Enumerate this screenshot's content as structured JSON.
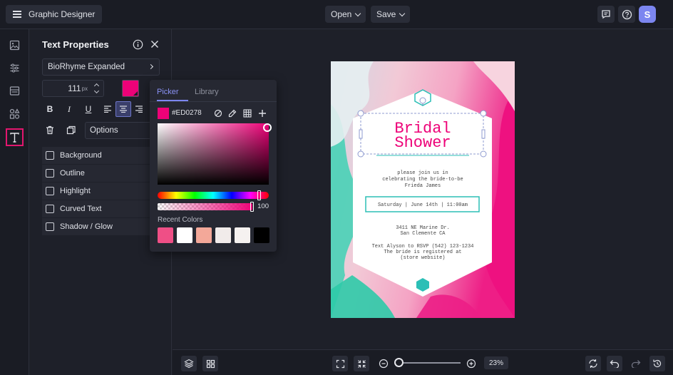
{
  "app": {
    "title": "Graphic Designer"
  },
  "topbar": {
    "open_label": "Open",
    "save_label": "Save",
    "avatar_initial": "S",
    "avatar_color": "#7c86f0"
  },
  "leftnav": {
    "items": [
      "image-icon",
      "sliders-icon",
      "layout-icon",
      "elements-icon",
      "text-icon"
    ],
    "active": "text-icon",
    "active_color": "#e3166e"
  },
  "panel": {
    "title": "Text Properties",
    "font_name": "BioRhyme Expanded",
    "font_size": "111",
    "font_size_unit": "px",
    "text_color": "#ED0278",
    "options_label": "Options",
    "alignment": "center",
    "format_buttons": {
      "bold": "B",
      "italic": "I",
      "underline": "U"
    },
    "effects": [
      "Background",
      "Outline",
      "Highlight",
      "Curved Text",
      "Shadow / Glow"
    ]
  },
  "picker": {
    "tabs": [
      "Picker",
      "Library"
    ],
    "active_tab": "Picker",
    "hex_value": "#ED0278",
    "opacity": "100",
    "recent_label": "Recent Colors",
    "recent_colors": [
      "#ef4f86",
      "#ffffff",
      "#f3a899",
      "#f1ebea",
      "#f5f1f0",
      "#000000"
    ]
  },
  "design": {
    "title_line1": "Bridal",
    "title_line2": "Shower",
    "invite_lines": [
      "please join us in",
      "celebrating the bride-to-be",
      "Frieda James"
    ],
    "date_line": "Saturday | June 14th | 11:00am",
    "address_lines": [
      "3411 NE Marine Dr.",
      "San Clemente CA"
    ],
    "rsvp_lines": [
      "Text Alyson to RSVP (542) 123-1234",
      "The bride is registered at",
      "(store website)"
    ],
    "accent_color": "#2bbfb6",
    "title_color": "#ED0278"
  },
  "bottombar": {
    "zoom": "23%"
  }
}
